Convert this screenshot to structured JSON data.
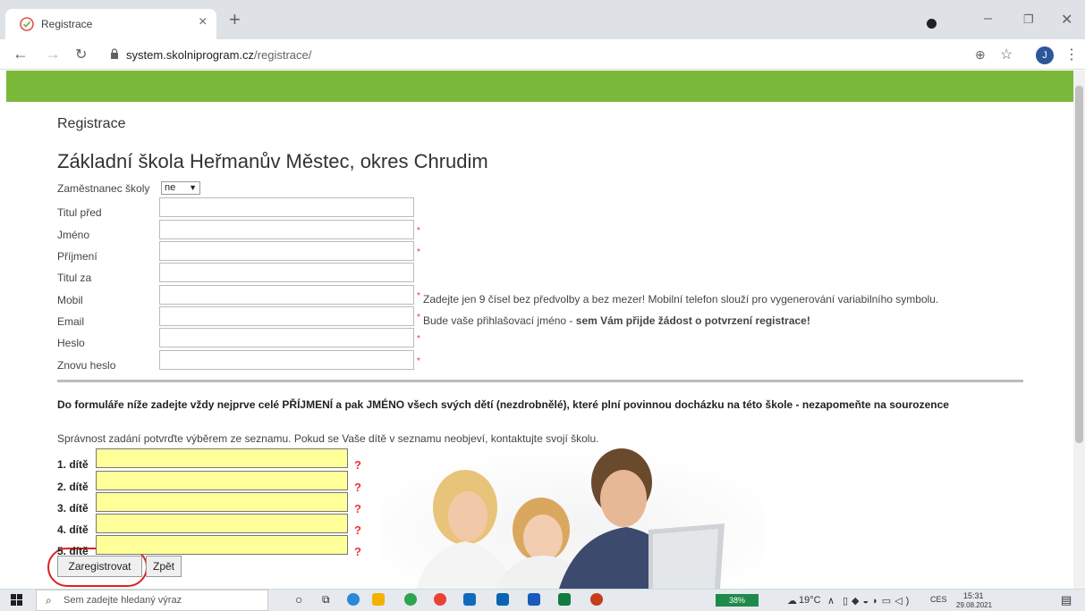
{
  "browser": {
    "tab_title": "Registrace",
    "url_host": "system.skolniprogram.cz",
    "url_path": "/registrace/",
    "avatar_letter": "J"
  },
  "page": {
    "heading": "Registrace",
    "school": "Základní škola Heřmanův Městec, okres Chrudim",
    "employee_label": "Zaměstnanec školy",
    "employee_value": "ne",
    "fields": [
      {
        "label": "Titul před",
        "required": false,
        "hint": "",
        "hint_bold": ""
      },
      {
        "label": "Jméno",
        "required": true,
        "hint": "",
        "hint_bold": ""
      },
      {
        "label": "Příjmení",
        "required": true,
        "hint": "",
        "hint_bold": ""
      },
      {
        "label": "Titul za",
        "required": false,
        "hint": "",
        "hint_bold": ""
      },
      {
        "label": "Mobil",
        "required": true,
        "hint": "Zadejte jen 9 čísel bez předvolby a bez mezer! Mobilní telefon slouží pro vygenerování variabilního symbolu.",
        "hint_bold": ""
      },
      {
        "label": "Email",
        "required": true,
        "hint": "Bude vaše přihlašovací jméno - ",
        "hint_bold": "sem Vám přijde žádost o potvrzení registrace!"
      },
      {
        "label": "Heslo",
        "required": true,
        "hint": "",
        "hint_bold": ""
      },
      {
        "label": "Znovu heslo",
        "required": true,
        "hint": "",
        "hint_bold": ""
      }
    ],
    "children_instructions": "Do formuláře níže zadejte vždy nejprve celé PŘÍJMENÍ a pak JMÉNO všech svých dětí (nezdrobnělé), které plní povinnou docházku na této škole - nezapomeňte na sourozence",
    "children_note": "Správnost zadání potvrďte výběrem ze seznamu. Pokud se Vaše dítě v seznamu neobjeví, kontaktujte svojí školu.",
    "children": [
      "1. dítě",
      "2. dítě",
      "3. dítě",
      "4. dítě",
      "5. dítě"
    ],
    "help_mark": "?",
    "required_mark": "*",
    "register_button": "Zaregistrovat",
    "back_button": "Zpět"
  },
  "taskbar": {
    "search_placeholder": "Sem zadejte hledaný výraz",
    "battery": "38%",
    "weather": "19°C",
    "language": "CES",
    "time": "15:31",
    "date": "29.08.2021"
  },
  "colors": {
    "header_green": "#7ab93a",
    "child_input_yellow": "#ffff99",
    "required_red": "#e33"
  }
}
